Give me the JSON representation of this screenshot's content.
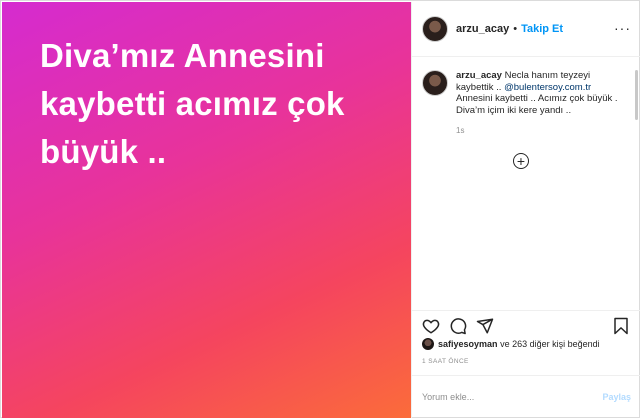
{
  "post_image": {
    "lines": [
      "Diva’mız Annesini",
      "kaybetti acımız çok",
      "büyük .."
    ]
  },
  "header": {
    "username": "arzu_acay",
    "separator": "•",
    "follow_label": "Takip Et",
    "more_label": "···"
  },
  "caption": {
    "username": "arzu_acay",
    "text_before_link": "Necla hanım teyzeyi kaybettik ..",
    "link": "@bulentersoy.com.tr",
    "text_after_link": "Annesini kaybetti .. Acımız çok büyük . Diva’m içim iki kere yandı ..",
    "time": "1s"
  },
  "load_more_icon": "plus-circle-icon",
  "likes": {
    "liker": "safiyesoyman",
    "rest": "ve 263 diğer kişi beğendi"
  },
  "post_time": "1 SAAT ÖNCE",
  "comment": {
    "placeholder": "Yorum ekle...",
    "share_label": "Paylaş"
  },
  "colors": {
    "accent": "#0095f6",
    "share_disabled": "#b3dbff",
    "gradient_start": "#d52bd0",
    "gradient_end": "#fb6c3a"
  }
}
